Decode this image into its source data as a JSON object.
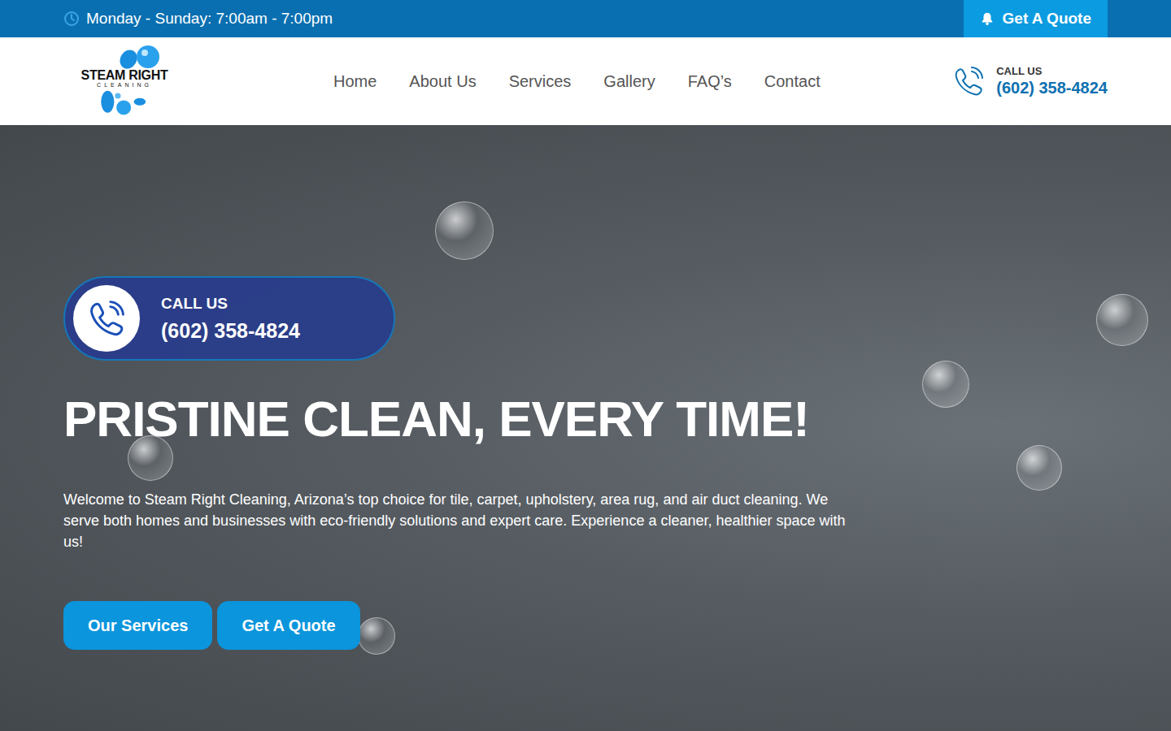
{
  "top_bar": {
    "hours": "Monday - Sunday: 7:00am - 7:00pm",
    "quote_button": "Get A Quote"
  },
  "logo": {
    "name": "STEAM RIGHT",
    "tagline": "CLEANING"
  },
  "nav": {
    "items": [
      "Home",
      "About Us",
      "Services",
      "Gallery",
      "FAQ’s",
      "Contact"
    ]
  },
  "header_call": {
    "label": "CALL US",
    "phone": "(602) 358-4824"
  },
  "hero": {
    "call": {
      "label": "CALL US",
      "phone": "(602) 358-4824"
    },
    "title": "PRISTINE CLEAN, EVERY TIME!",
    "text": "Welcome to Steam Right Cleaning, Arizona’s top choice for tile, carpet, upholstery, area rug, and air duct cleaning. We serve both homes and businesses with eco-friendly solutions and expert care. Experience a cleaner, healthier space with us!",
    "buttons": [
      "Our Services",
      "Get A Quote"
    ]
  }
}
